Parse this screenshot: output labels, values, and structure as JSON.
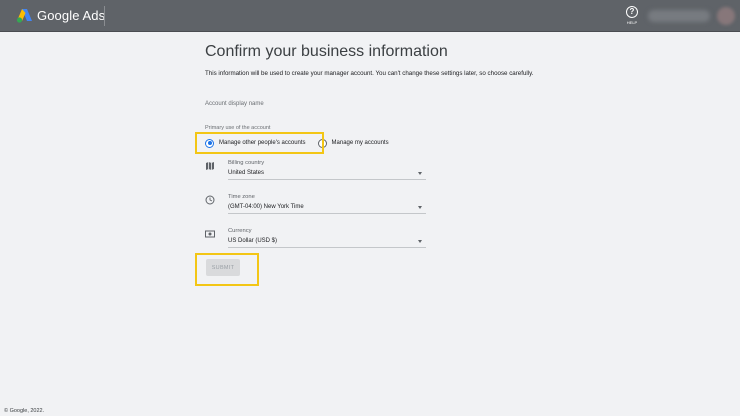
{
  "header": {
    "brand": "Google Ads",
    "help_label": "HELP",
    "help_glyph": "?"
  },
  "page": {
    "title": "Confirm your business information",
    "description": "This information will be used to create your manager account. You can't change these settings later, so choose carefully.",
    "account_display_name_label": "Account display name",
    "primary_use_label": "Primary use of the account",
    "radio_options": [
      {
        "label": "Manage other people's accounts",
        "selected": true
      },
      {
        "label": "Manage my accounts",
        "selected": false
      }
    ],
    "billing_country": {
      "label": "Billing country",
      "value": "United States",
      "icon": "map-icon"
    },
    "time_zone": {
      "label": "Time zone",
      "value": "(GMT-04:00) New York Time",
      "icon": "clock-icon"
    },
    "currency": {
      "label": "Currency",
      "value": "US Dollar (USD $)",
      "icon": "currency-icon"
    },
    "submit_label": "SUBMIT"
  },
  "footer": {
    "copyright": "© Google, 2022."
  },
  "colors": {
    "topbar": "#5f6368",
    "accent": "#1a73e8",
    "highlight": "#f3c615",
    "background": "#f1f2f4"
  }
}
